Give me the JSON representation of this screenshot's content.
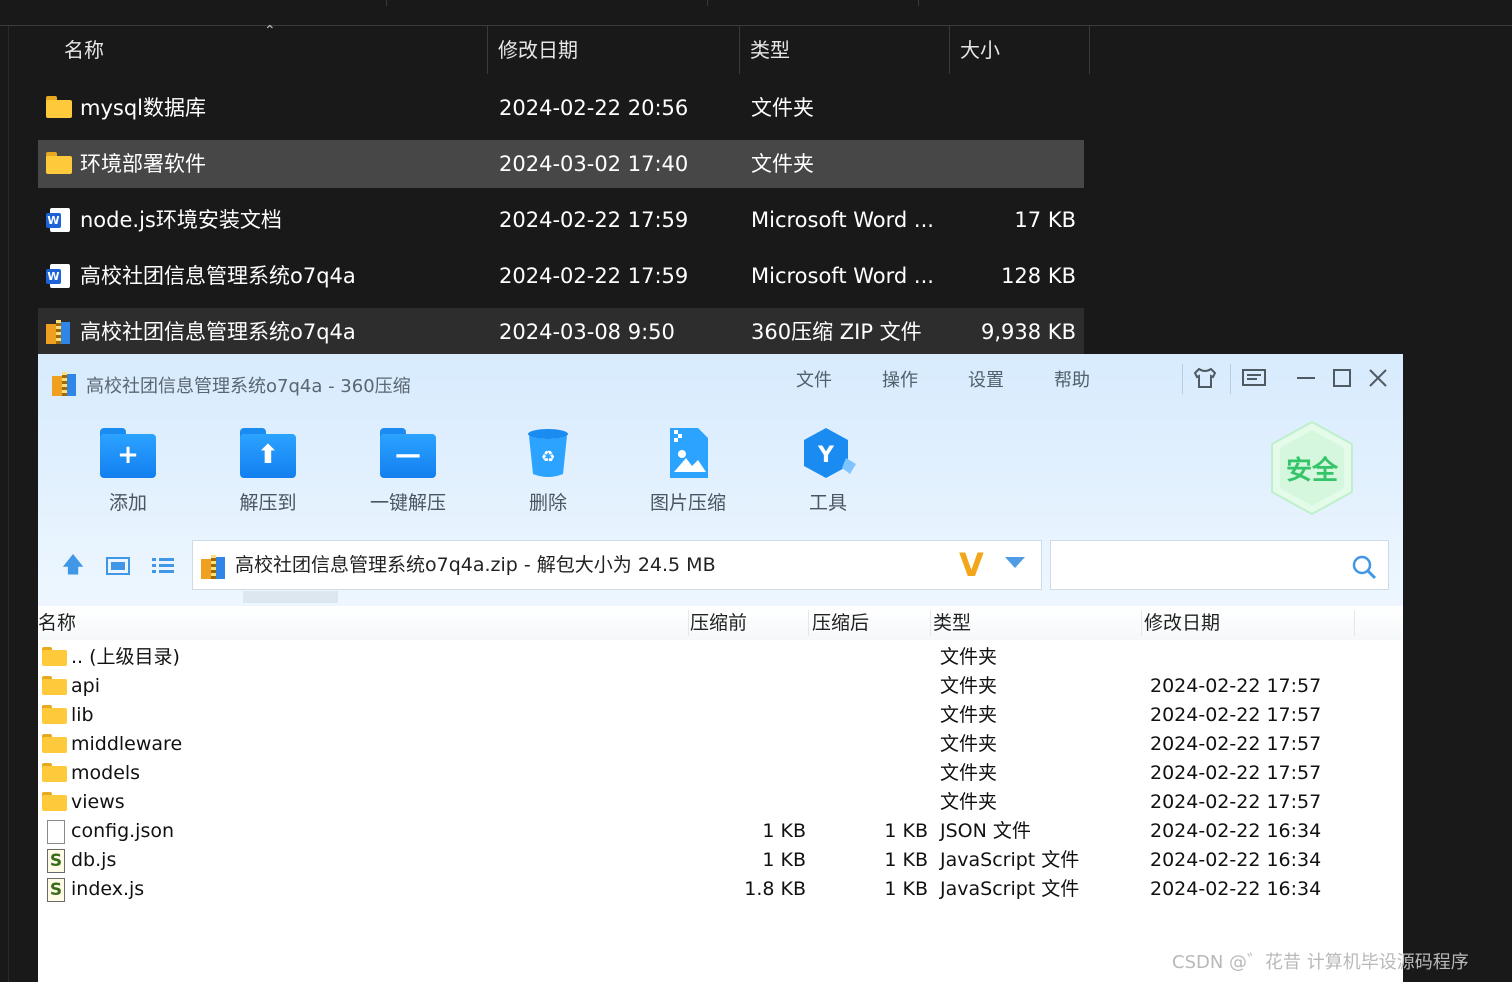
{
  "explorer": {
    "columns": {
      "name": "名称",
      "modified": "修改日期",
      "type": "类型",
      "size": "大小"
    },
    "rows": [
      {
        "icon": "folder-icon",
        "name": "mysql数据库",
        "modified": "2024-02-22 20:56",
        "type": "文件夹",
        "size": ""
      },
      {
        "icon": "folder-icon",
        "name": "环境部署软件",
        "modified": "2024-03-02 17:40",
        "type": "文件夹",
        "size": ""
      },
      {
        "icon": "word-doc-icon",
        "name": "node.js环境安装文档",
        "modified": "2024-02-22 17:59",
        "type": "Microsoft Word ...",
        "size": "17 KB"
      },
      {
        "icon": "word-doc-icon",
        "name": "高校社团信息管理系统o7q4a",
        "modified": "2024-02-22 17:59",
        "type": "Microsoft Word ...",
        "size": "128 KB"
      },
      {
        "icon": "zip-archive-icon",
        "name": "高校社团信息管理系统o7q4a",
        "modified": "2024-03-08 9:50",
        "type": "360压缩 ZIP 文件",
        "size": "9,938 KB"
      }
    ]
  },
  "zipwin": {
    "title": "高校社团信息管理系统o7q4a - 360压缩",
    "menu": {
      "file": "文件",
      "operate": "操作",
      "settings": "设置",
      "help": "帮助"
    },
    "toolbar": {
      "add": "添加",
      "extract_to": "解压到",
      "one_click": "一键解压",
      "delete": "删除",
      "image_compress": "图片压缩",
      "tools": "工具"
    },
    "safe_badge": "安全",
    "address": "高校社团信息管理系统o7q4a.zip - 解包大小为 24.5 MB",
    "columns": {
      "name": "名称",
      "before": "压缩前",
      "after": "压缩后",
      "type": "类型",
      "modified": "修改日期"
    },
    "rows": [
      {
        "icon": "folder-icon",
        "name": ".. (上级目录)",
        "before": "",
        "after": "",
        "type": "文件夹",
        "modified": ""
      },
      {
        "icon": "folder-icon",
        "name": "api",
        "before": "",
        "after": "",
        "type": "文件夹",
        "modified": "2024-02-22 17:57"
      },
      {
        "icon": "folder-icon",
        "name": "lib",
        "before": "",
        "after": "",
        "type": "文件夹",
        "modified": "2024-02-22 17:57"
      },
      {
        "icon": "folder-icon",
        "name": "middleware",
        "before": "",
        "after": "",
        "type": "文件夹",
        "modified": "2024-02-22 17:57"
      },
      {
        "icon": "folder-icon",
        "name": "models",
        "before": "",
        "after": "",
        "type": "文件夹",
        "modified": "2024-02-22 17:57"
      },
      {
        "icon": "folder-icon",
        "name": "views",
        "before": "",
        "after": "",
        "type": "文件夹",
        "modified": "2024-02-22 17:57"
      },
      {
        "icon": "json-file-icon",
        "name": "config.json",
        "before": "1 KB",
        "after": "1 KB",
        "type": "JSON 文件",
        "modified": "2024-02-22 16:34"
      },
      {
        "icon": "js-file-icon",
        "name": "db.js",
        "before": "1 KB",
        "after": "1 KB",
        "type": "JavaScript 文件",
        "modified": "2024-02-22 16:34"
      },
      {
        "icon": "js-file-icon",
        "name": "index.js",
        "before": "1.8 KB",
        "after": "1 KB",
        "type": "JavaScript 文件",
        "modified": "2024-02-22 16:34"
      }
    ]
  },
  "watermark": "CSDN @゛花昔 计算机毕设源码程序",
  "colors": {
    "explorer_bg": "#191919",
    "selected_row": "#474747",
    "accent_blue": "#1a8bf0",
    "zip_accent": "#f3a619",
    "safe_green": "#36c46a"
  }
}
